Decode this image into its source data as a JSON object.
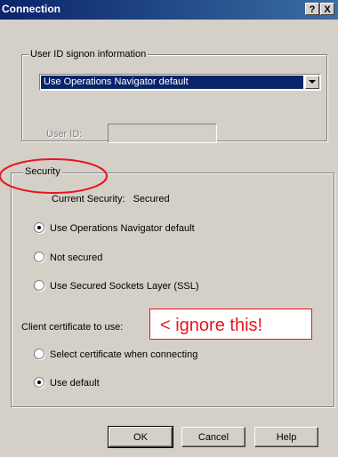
{
  "window": {
    "title": "Connection",
    "help_glyph": "?",
    "close_glyph": "X"
  },
  "signon": {
    "legend": "User ID signon information",
    "dropdown_value": "Use Operations Navigator default",
    "userid_label": "User ID:",
    "userid_value": ""
  },
  "security": {
    "legend": "Security",
    "current_label": "Current Security:",
    "current_value": "Secured",
    "options": [
      {
        "label": "Use Operations Navigator default",
        "checked": true
      },
      {
        "label": "Not secured",
        "checked": false
      },
      {
        "label": "Use Secured Sockets Layer (SSL)",
        "checked": false
      }
    ],
    "cert_label": "Client certificate to use:",
    "cert_options": [
      {
        "label": "Select certificate when connecting",
        "checked": false
      },
      {
        "label": "Use default",
        "checked": true
      }
    ]
  },
  "annotation": {
    "text": "< ignore this!",
    "color": "#e8141e"
  },
  "buttons": {
    "ok": "OK",
    "cancel": "Cancel",
    "help": "Help"
  },
  "icons": {
    "dropdown_arrow": "chevron-down-icon",
    "help": "help-icon",
    "close": "close-icon"
  },
  "colors": {
    "titlebar_start": "#0a246a",
    "titlebar_end": "#3a6ea5",
    "face": "#d4d0c8",
    "selection": "#0a246a"
  }
}
